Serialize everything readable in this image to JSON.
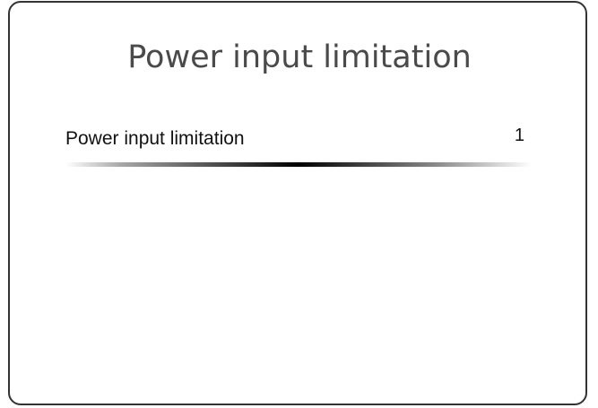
{
  "screen": {
    "title": "Power input limitation"
  },
  "menu": {
    "items": [
      {
        "label": "Power input limitation",
        "value": "1"
      }
    ]
  }
}
